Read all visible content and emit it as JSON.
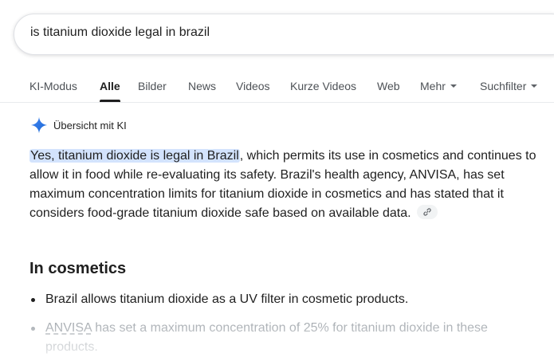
{
  "search": {
    "query": "is titanium dioxide legal in brazil"
  },
  "tabs": [
    {
      "label": "KI-Modus"
    },
    {
      "label": "Alle",
      "active": true
    },
    {
      "label": "Bilder"
    },
    {
      "label": "News"
    },
    {
      "label": "Videos"
    },
    {
      "label": "Kurze Videos"
    },
    {
      "label": "Web"
    },
    {
      "label": "Mehr"
    },
    {
      "label": "Suchfilter"
    }
  ],
  "ai_overview": {
    "title": "Übersicht mit KI",
    "highlight": "Yes, titanium dioxide is legal in Brazil",
    "body": ", which permits its use in cosmetics and continues to allow it in food while re-evaluating its safety. Brazil's health agency, ANVISA, has set maximum concentration limits for titanium dioxide in cosmetics and has stated that it considers food-grade titanium dioxide safe based on available data.",
    "link_icon": "link-icon"
  },
  "section": {
    "heading": "In cosmetics",
    "bullets": [
      "Brazil allows titanium dioxide as a UV filter in cosmetic products.",
      {
        "prefix": "ANVISA",
        "rest": " has set a maximum concentration of 25% for titanium dioxide in these products."
      }
    ]
  },
  "colors": {
    "highlight": "#d3e3fd",
    "sparkle": "#1a73e8",
    "text": "#1f1f1f",
    "muted": "#4d5156"
  }
}
